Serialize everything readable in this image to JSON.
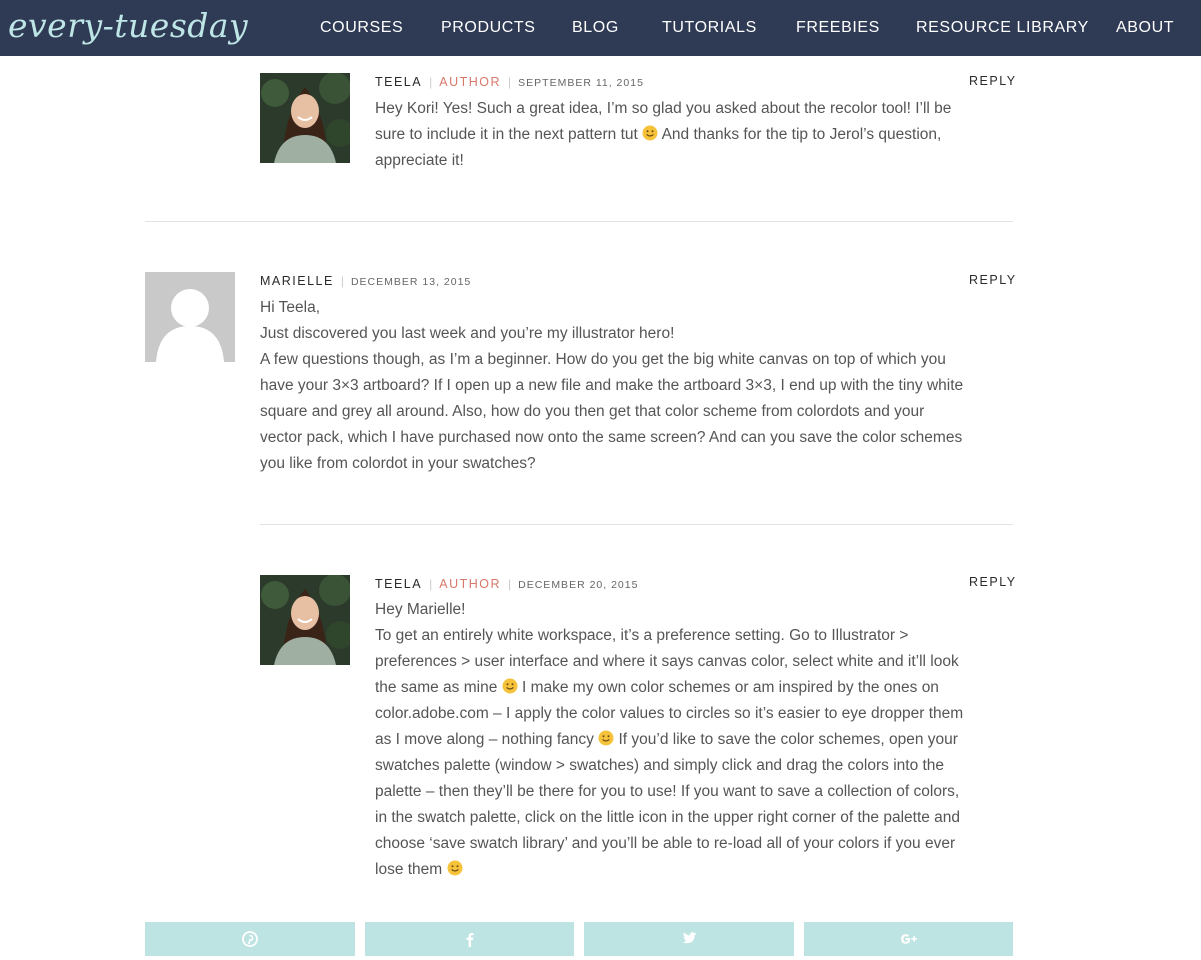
{
  "header": {
    "logo": "every-tuesday",
    "nav": [
      {
        "label": "COURSES"
      },
      {
        "label": "PRODUCTS"
      },
      {
        "label": "BLOG"
      },
      {
        "label": "TUTORIALS"
      },
      {
        "label": "FREEBIES"
      },
      {
        "label": "RESOURCE LIBRARY"
      },
      {
        "label": "ABOUT"
      }
    ]
  },
  "comments": [
    {
      "name": "TEELA",
      "badge": "AUTHOR",
      "date": "SEPTEMBER 11, 2015",
      "reply": "REPLY",
      "body": [
        "Hey Kori! Yes! Such a great idea, I’m so glad you asked about the recolor tool! I’ll be",
        "sure to include it in the next pattern tut",
        "And thanks for the tip to Jerol’s question,",
        "appreciate it!"
      ]
    },
    {
      "name": "MARIELLE",
      "date": "DECEMBER 13, 2015",
      "reply": "REPLY",
      "body": [
        "Hi Teela,",
        "Just discovered you last week and you’re my illustrator hero!",
        "A few questions though, as I’m a beginner. How do you get the big white canvas on top of which you",
        "have your 3×3 artboard? If I open up a new file and make the artboard 3×3, I end up with the tiny white",
        "square and grey all around. Also, how do you then get that color scheme from colordots and your",
        "vector pack, which I have purchased now onto the same screen? And can you save the color schemes",
        "you like from colordot in your swatches?"
      ]
    },
    {
      "name": "TEELA",
      "badge": "AUTHOR",
      "date": "DECEMBER 20, 2015",
      "reply": "REPLY",
      "body": [
        "Hey Marielle!",
        "To get an entirely white workspace, it’s a preference setting. Go to Illustrator >",
        "preferences > user interface and where it says canvas color, select white and it’ll look",
        "the same as mine",
        "I make my own color schemes or am inspired by the ones on",
        "color.adobe.com – I apply the color values to circles so it’s easier to eye dropper them",
        "as I move along – nothing fancy",
        "If you’d like to save the color schemes, open your",
        "swatches palette (window > swatches) and simply click and drag the colors into the",
        "palette – then they’ll be there for you to use! If you want to save a collection of colors,",
        "in the swatch palette, click on the little icon in the upper right corner of the palette and",
        "choose ‘save swatch library’ and you’ll be able to re-load all of your colors if you ever",
        "lose them"
      ]
    }
  ],
  "share": [
    {
      "icon": "pinterest-icon"
    },
    {
      "icon": "facebook-icon"
    },
    {
      "icon": "twitter-icon"
    },
    {
      "icon": "google-plus-icon"
    }
  ],
  "colors": {
    "header_bg": "#2f3a55",
    "logo": "#bfe6e6",
    "author_badge": "#d8786a",
    "share_bg": "#bde4e2"
  }
}
